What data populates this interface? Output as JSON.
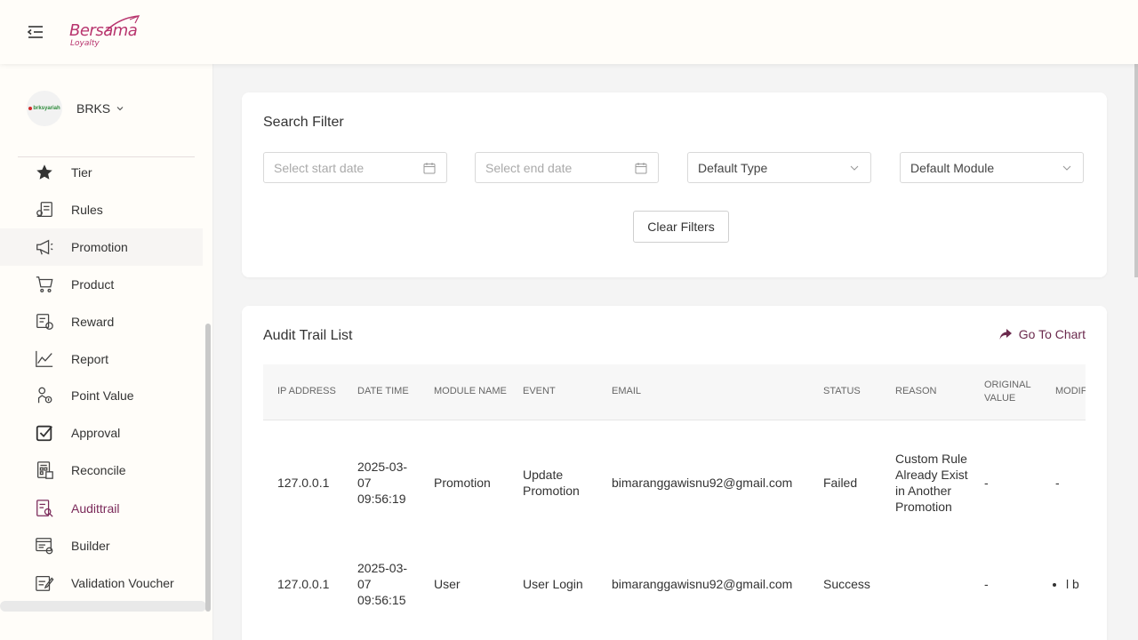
{
  "header": {
    "logo_text": "Bersama",
    "logo_sub": "Loyalty"
  },
  "org": {
    "name": "BRKS",
    "logo_text": "brksyariah"
  },
  "sidebar": {
    "items": [
      {
        "label": "Tier",
        "icon": "star-icon"
      },
      {
        "label": "Rules",
        "icon": "rules-icon"
      },
      {
        "label": "Promotion",
        "icon": "megaphone-icon"
      },
      {
        "label": "Product",
        "icon": "cart-icon"
      },
      {
        "label": "Reward",
        "icon": "reward-icon"
      },
      {
        "label": "Report",
        "icon": "line-chart-icon"
      },
      {
        "label": "Point Value",
        "icon": "point-value-icon"
      },
      {
        "label": "Approval",
        "icon": "check-square-icon"
      },
      {
        "label": "Reconcile",
        "icon": "reconcile-icon"
      },
      {
        "label": "Audittrail",
        "icon": "audit-icon"
      },
      {
        "label": "Builder",
        "icon": "builder-icon"
      },
      {
        "label": "Validation Voucher",
        "icon": "voucher-icon"
      }
    ]
  },
  "filter": {
    "title": "Search Filter",
    "start_date_placeholder": "Select start date",
    "end_date_placeholder": "Select end date",
    "type_value": "Default Type",
    "module_value": "Default Module",
    "clear_label": "Clear Filters"
  },
  "list": {
    "title": "Audit Trail List",
    "go_chart_label": "Go To Chart",
    "columns": {
      "ip": "IP ADDRESS",
      "datetime": "DATE TIME",
      "module": "MODULE NAME",
      "event": "EVENT",
      "email": "EMAIL",
      "status": "STATUS",
      "reason": "REASON",
      "original": "ORIGINAL VALUE",
      "modified": "MODIFIED"
    },
    "rows": [
      {
        "ip": "127.0.0.1",
        "datetime": "2025-03-07 09:56:19",
        "module": "Promotion",
        "event": "Update Promotion",
        "email": "bimaranggawisnu92@gmail.com",
        "status": "Failed",
        "reason": "Custom Rule Already Exist in Another Promotion",
        "original": "-",
        "modified": "-"
      },
      {
        "ip": "127.0.0.1",
        "datetime": "2025-03-07 09:56:15",
        "module": "User",
        "event": "User Login",
        "email": "bimaranggawisnu92@gmail.com",
        "status": "Success",
        "reason": "",
        "original": "-",
        "modified": "l b"
      }
    ]
  }
}
